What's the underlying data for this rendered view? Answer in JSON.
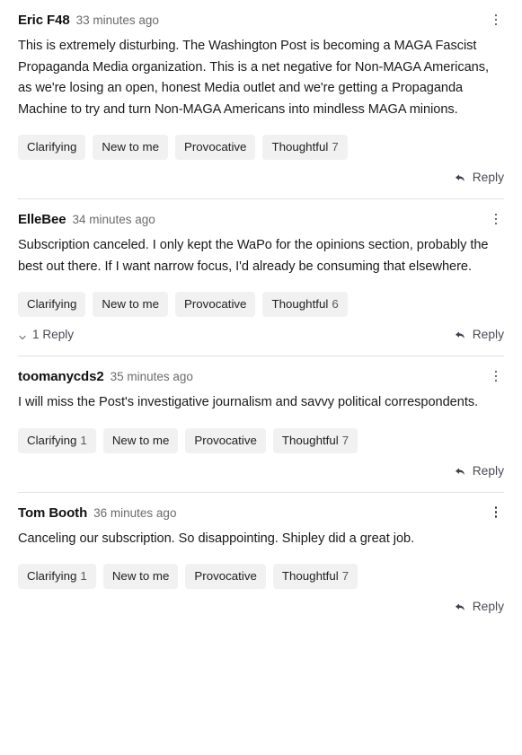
{
  "thread": {
    "comments": [
      {
        "author": "Eric F48",
        "timestamp": "33 minutes ago",
        "body": "This is extremely disturbing. The Washington Post is becoming a MAGA Fascist Propaganda Media organization. This is a net negative for Non-MAGA Americans, as we're losing an open, honest Media outlet and we're getting a Propaganda Machine to try and turn Non-MAGA Americans into mindless MAGA minions.",
        "reactions": [
          {
            "label": "Clarifying",
            "count": ""
          },
          {
            "label": "New to me",
            "count": ""
          },
          {
            "label": "Provocative",
            "count": ""
          },
          {
            "label": "Thoughtful",
            "count": "7"
          }
        ],
        "replies_label": "",
        "reply_label": "Reply",
        "has_replies_expander": false,
        "has_divider_above": false
      },
      {
        "author": "ElleBee",
        "timestamp": "34 minutes ago",
        "body": "Subscription canceled. I only kept the WaPo for the opinions section, probably the best out there. If I want narrow focus, I'd already be consuming that elsewhere.",
        "reactions": [
          {
            "label": "Clarifying",
            "count": ""
          },
          {
            "label": "New to me",
            "count": ""
          },
          {
            "label": "Provocative",
            "count": ""
          },
          {
            "label": "Thoughtful",
            "count": "6"
          }
        ],
        "replies_label": "1 Reply",
        "reply_label": "Reply",
        "has_replies_expander": true,
        "has_divider_above": true
      },
      {
        "author": "toomanycds2",
        "timestamp": "35 minutes ago",
        "body": "I will miss the Post's investigative journalism and savvy political correspondents.",
        "reactions": [
          {
            "label": "Clarifying",
            "count": "1"
          },
          {
            "label": "New to me",
            "count": ""
          },
          {
            "label": "Provocative",
            "count": ""
          },
          {
            "label": "Thoughtful",
            "count": "7"
          }
        ],
        "replies_label": "",
        "reply_label": "Reply",
        "has_replies_expander": false,
        "has_divider_above": true
      },
      {
        "author": "Tom Booth",
        "timestamp": "36 minutes ago",
        "body": "Canceling our subscription. So disappointing. Shipley did a great job.",
        "reactions": [
          {
            "label": "Clarifying",
            "count": "1"
          },
          {
            "label": "New to me",
            "count": ""
          },
          {
            "label": "Provocative",
            "count": ""
          },
          {
            "label": "Thoughtful",
            "count": "7"
          }
        ],
        "replies_label": "",
        "reply_label": "Reply",
        "has_replies_expander": false,
        "has_divider_above": true
      }
    ]
  },
  "icons": {
    "kebab": "more-options-icon",
    "reply_arrow": "reply-arrow-icon",
    "chevron_down": "chevron-down-icon"
  },
  "colors": {
    "chip_background": "#f1f1f1",
    "divider": "#e2e2e2",
    "text_primary": "#1a1a1a",
    "text_muted": "#6b6b6b",
    "link": "#4a4a55"
  }
}
